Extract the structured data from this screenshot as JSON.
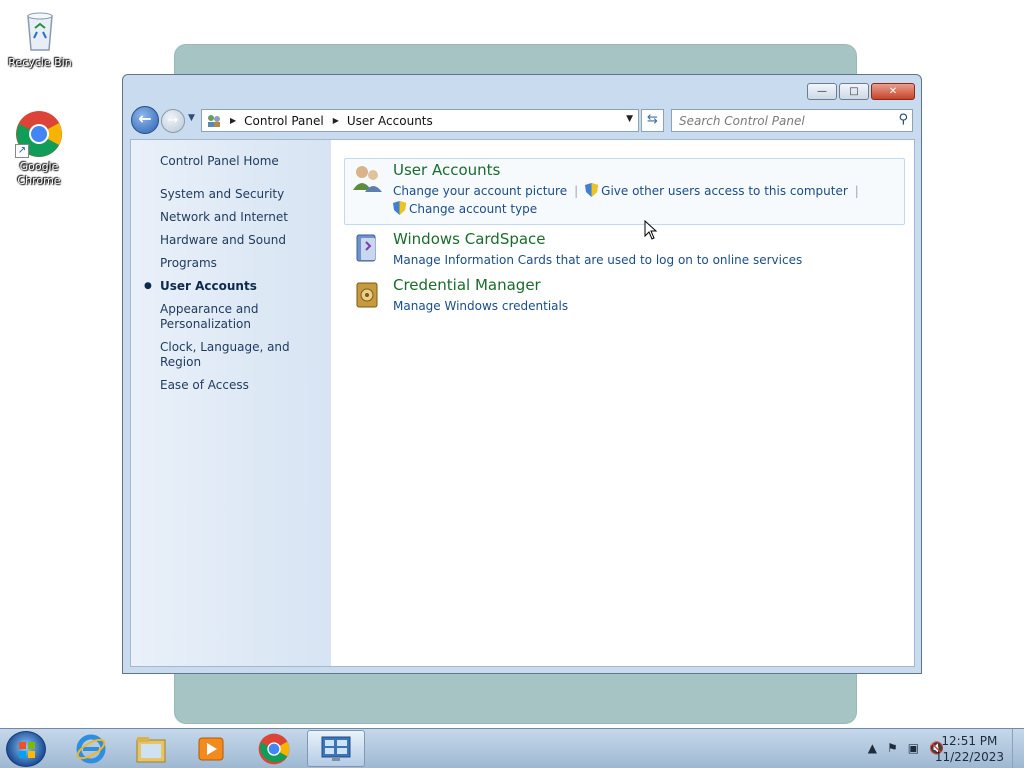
{
  "desktop": {
    "icons": [
      {
        "label": "Recycle Bin",
        "icon": "recycle-bin-icon"
      },
      {
        "label": "Google Chrome",
        "icon": "chrome-icon"
      }
    ]
  },
  "window": {
    "controls": {
      "minimize": "—",
      "maximize": "□",
      "close": "✕"
    },
    "address": {
      "crumbs": [
        "Control Panel",
        "User Accounts"
      ]
    },
    "search": {
      "placeholder": "Search Control Panel"
    },
    "sidebar": {
      "home": "Control Panel Home",
      "categories": [
        {
          "label": "System and Security",
          "active": false
        },
        {
          "label": "Network and Internet",
          "active": false
        },
        {
          "label": "Hardware and Sound",
          "active": false
        },
        {
          "label": "Programs",
          "active": false
        },
        {
          "label": "User Accounts",
          "active": true
        },
        {
          "label": "Appearance and Personalization",
          "active": false
        },
        {
          "label": "Clock, Language, and Region",
          "active": false
        },
        {
          "label": "Ease of Access",
          "active": false
        }
      ]
    },
    "groups": [
      {
        "title": "User Accounts",
        "links": [
          "Change your account picture",
          "Give other users access to this computer",
          "Change account type"
        ]
      },
      {
        "title": "Windows CardSpace",
        "links": [
          "Manage Information Cards that are used to log on to online services"
        ]
      },
      {
        "title": "Credential Manager",
        "links": [
          "Manage Windows credentials"
        ]
      }
    ]
  },
  "taskbar": {
    "items": [
      "start-button",
      "internet-explorer",
      "file-explorer",
      "media-player",
      "chrome",
      "control-panel"
    ],
    "clock": {
      "time": "12:51 PM",
      "date": "11/22/2023"
    }
  }
}
